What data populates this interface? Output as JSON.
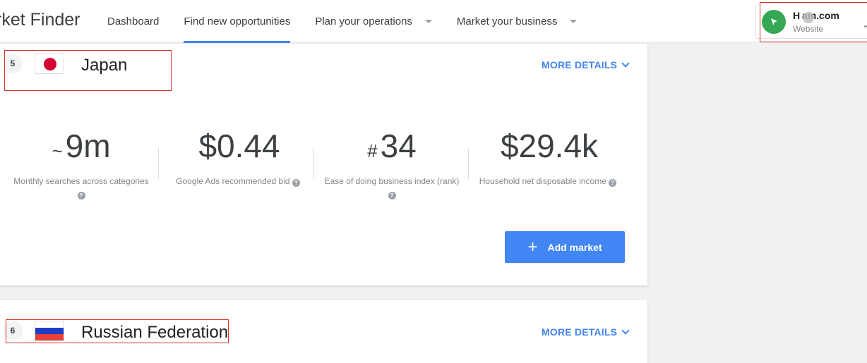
{
  "header": {
    "brand": "rket Finder",
    "nav": [
      {
        "label": "Dashboard"
      },
      {
        "label": "Find new opportunities"
      },
      {
        "label": "Plan your operations"
      },
      {
        "label": "Market your business"
      }
    ],
    "account": {
      "name": "H am.com",
      "type": "Website"
    }
  },
  "markets": [
    {
      "rank": "5",
      "country": "Japan",
      "more_details": "MORE DETAILS",
      "metrics": [
        {
          "prefix": "~",
          "value": "9m",
          "label": "Monthly searches across categories"
        },
        {
          "prefix": "",
          "value": "$0.44",
          "label": "Google Ads recommended bid"
        },
        {
          "prefix": "#",
          "value": "34",
          "label": "Ease of doing business index (rank)"
        },
        {
          "prefix": "",
          "value": "$29.4k",
          "label": "Household net disposable income"
        }
      ],
      "add_button": "Add market"
    },
    {
      "rank": "6",
      "country": "Russian Federation",
      "more_details": "MORE DETAILS"
    }
  ],
  "colors": {
    "accent": "#4285f4",
    "highlight": "#d93025",
    "avatar": "#34a853"
  }
}
